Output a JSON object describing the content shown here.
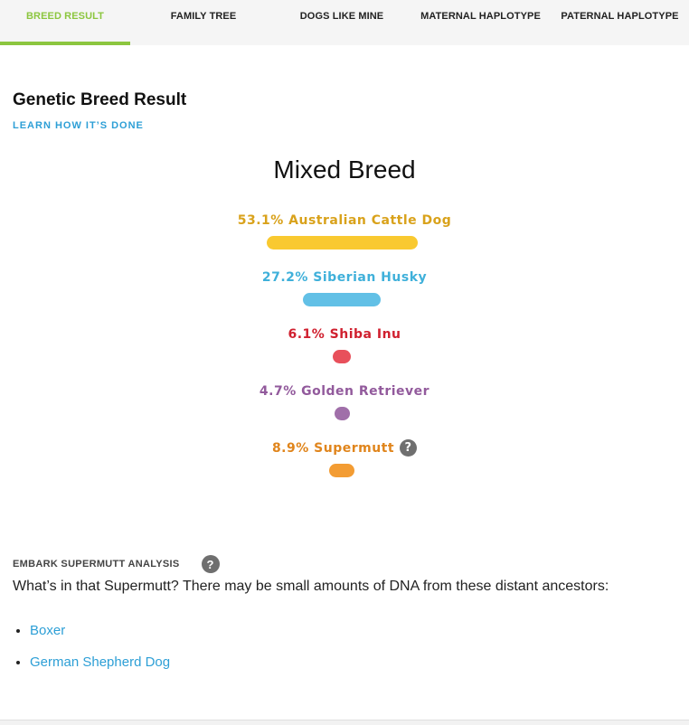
{
  "tabs": [
    {
      "label": "BREED RESULT",
      "active": true
    },
    {
      "label": "FAMILY TREE",
      "active": false
    },
    {
      "label": "DOGS LIKE MINE",
      "active": false
    },
    {
      "label": "MATERNAL HAPLOTYPE",
      "active": false
    },
    {
      "label": "PATERNAL HAPLOTYPE",
      "active": false
    }
  ],
  "section": {
    "title": "Genetic Breed Result",
    "learn_link": "LEARN HOW IT’S DONE"
  },
  "result": {
    "heading": "Mixed Breed",
    "breeds": [
      {
        "label": "53.1% Australian Cattle Dog",
        "percent": 53.1,
        "color": "#f9c930",
        "text_color": "#d9a21b"
      },
      {
        "label": "27.2% Siberian Husky",
        "percent": 27.2,
        "color": "#62c0e6",
        "text_color": "#3fb0da"
      },
      {
        "label": "6.1% Shiba Inu",
        "percent": 6.1,
        "color": "#e8505b",
        "text_color": "#d0202f"
      },
      {
        "label": "4.7% Golden Retriever",
        "percent": 4.7,
        "color": "#a06fa9",
        "text_color": "#925a9c"
      },
      {
        "label": "8.9% Supermutt",
        "percent": 8.9,
        "color": "#f39c33",
        "text_color": "#e0851c",
        "help": "?"
      }
    ]
  },
  "supermutt": {
    "title": "EMBARK SUPERMUTT ANALYSIS",
    "help": "?",
    "description": "What’s in that Supermutt? There may be small amounts of DNA from these distant ancestors:",
    "ancestors": [
      "Boxer",
      "German Shepherd Dog"
    ]
  }
}
